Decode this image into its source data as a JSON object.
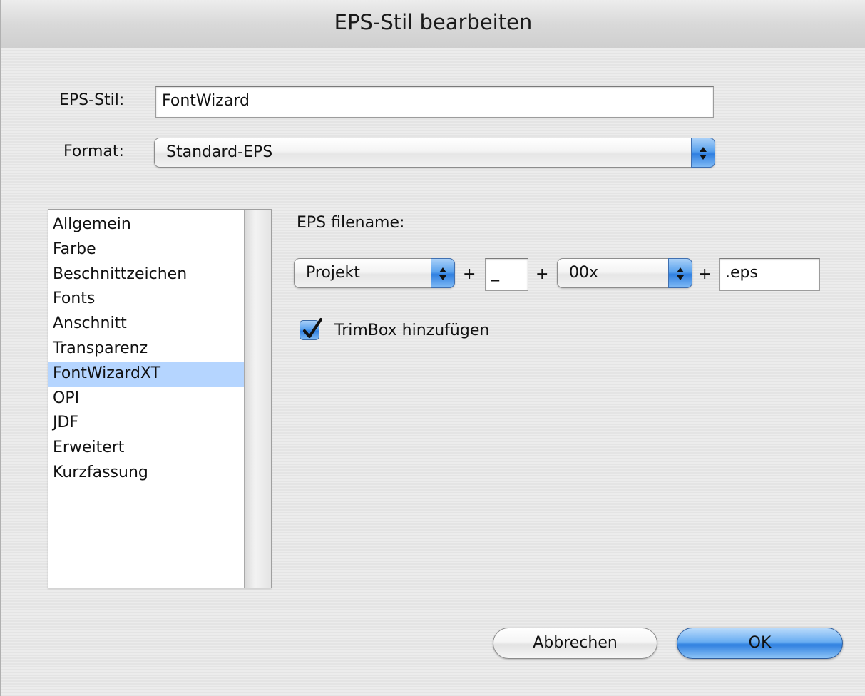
{
  "window": {
    "title": "EPS-Stil bearbeiten"
  },
  "form": {
    "eps_style_label": "EPS-Stil:",
    "eps_style_value": "FontWizard",
    "format_label": "Format:",
    "format_value": "Standard-EPS"
  },
  "sidebar": {
    "items": [
      {
        "label": "Allgemein"
      },
      {
        "label": "Farbe"
      },
      {
        "label": "Beschnittzeichen"
      },
      {
        "label": "Fonts"
      },
      {
        "label": "Anschnitt"
      },
      {
        "label": "Transparenz"
      },
      {
        "label": "FontWizardXT",
        "selected": true
      },
      {
        "label": "OPI"
      },
      {
        "label": "JDF"
      },
      {
        "label": "Erweitert"
      },
      {
        "label": "Kurzfassung"
      }
    ]
  },
  "filename": {
    "label": "EPS filename:",
    "part1": "Projekt",
    "plus": "+",
    "separator": "_",
    "part2": "00x",
    "extension": ".eps"
  },
  "trimbox": {
    "label": "TrimBox hinzufügen",
    "checked": true
  },
  "buttons": {
    "cancel": "Abbrechen",
    "ok": "OK"
  },
  "colors": {
    "accent": "#2f80e0",
    "selection": "#b5d5ff"
  },
  "icons": {
    "popup_arrows": "up-down-arrows-icon",
    "checkbox": "checkmark-icon"
  }
}
